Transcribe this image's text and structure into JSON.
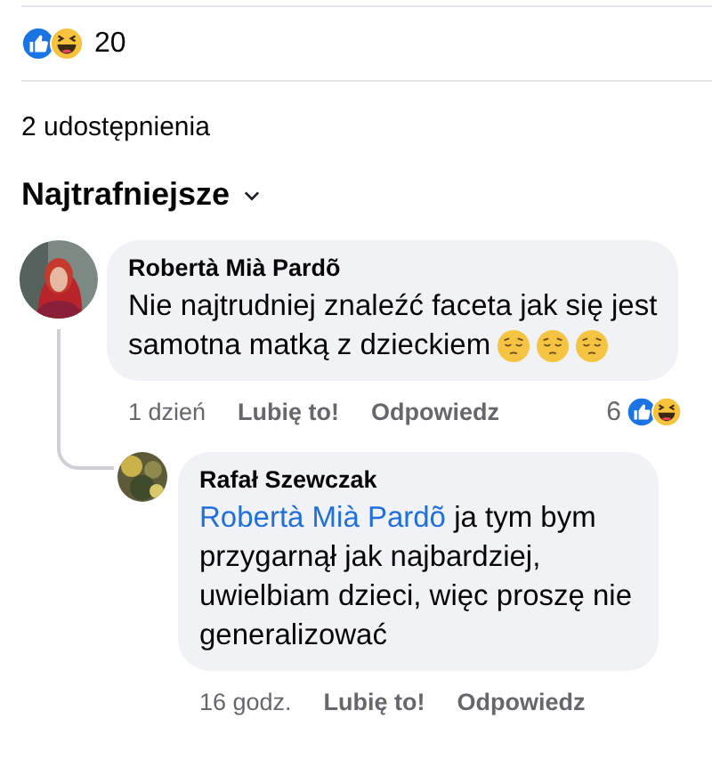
{
  "post_reactions": {
    "icons": [
      {
        "kind": "like"
      },
      {
        "kind": "haha"
      }
    ],
    "count": "20"
  },
  "shares": "2 udostępnienia",
  "sort": {
    "label": "Najtrafniejsze"
  },
  "comments": [
    {
      "author": "Robertà Mià Pardõ",
      "lines": [
        "Nie najtrudniej znaleźć faceta jak się jest",
        "samotna matką z dzieckiem"
      ],
      "emoji": [
        {
          "kind": "pensive"
        },
        {
          "kind": "pensive"
        },
        {
          "kind": "pensive"
        }
      ],
      "time": "1 dzień",
      "actions": [
        "Lubię to!",
        "Odpowiedz"
      ],
      "reactions": {
        "count": "6",
        "icons": [
          {
            "kind": "like"
          },
          {
            "kind": "haha"
          }
        ]
      },
      "replies": [
        {
          "author": "Rafał Szewczak",
          "mention": "Robertà Mià Pardõ",
          "text": "ja tym bym przygarnął jak najbardziej, uwielbiam dzieci, więc proszę nie generalizować",
          "time": "16 godz.",
          "actions": [
            "Lubię to!",
            "Odpowiedz"
          ]
        }
      ]
    }
  ]
}
